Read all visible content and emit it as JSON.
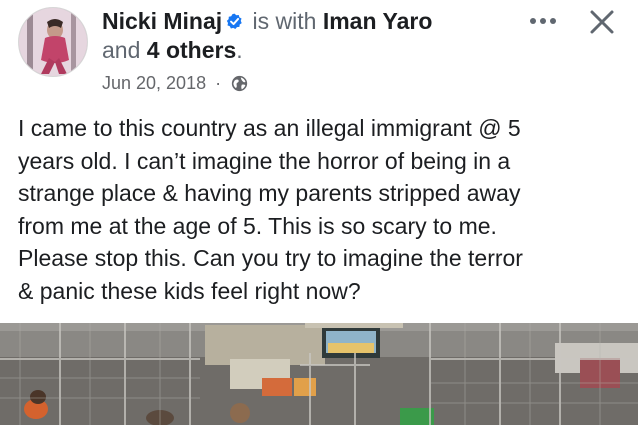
{
  "post": {
    "author": "Nicki Minaj",
    "with_text": "is with",
    "tagged_person": "Iman Yaro",
    "and_text": "and",
    "others_text": "4 others",
    "period": ".",
    "date": "Jun 20, 2018",
    "separator": "·",
    "privacy_icon": "globe-icon",
    "text_lines": [
      "I came to this country as an illegal immigrant @ 5",
      "years old. I can’t imagine the horror of being in a",
      "strange place & having my parents stripped away",
      "from me at the age of 5. This is so scary to me.",
      "Please stop this. Can you try to imagine the terror",
      "& panic these kids feel right now?"
    ]
  },
  "icons": {
    "verified": "verified-badge-icon",
    "more": "more-options-icon",
    "close": "close-icon"
  },
  "colors": {
    "verified_badge": "#1877f2",
    "secondary_text": "#65676b",
    "primary_text": "#1c1e21"
  }
}
